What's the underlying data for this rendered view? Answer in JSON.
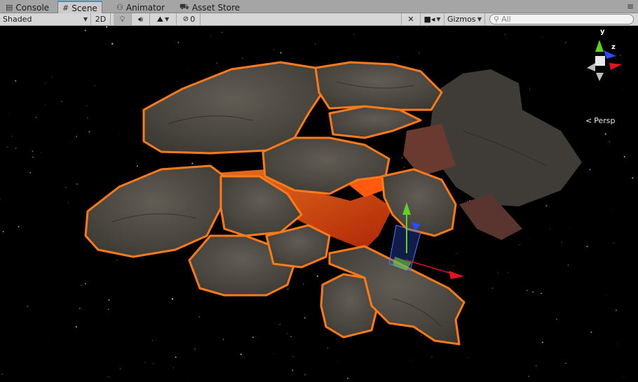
{
  "tabs": [
    {
      "label": "Console",
      "icon": "console-icon"
    },
    {
      "label": "Scene",
      "icon": "grid-icon"
    },
    {
      "label": "Animator",
      "icon": "animator-icon"
    },
    {
      "label": "Asset Store",
      "icon": "store-icon"
    }
  ],
  "active_tab": "Scene",
  "toolbar": {
    "shading_mode": "Shaded",
    "mode_2d": "2D",
    "hidden_count": "0",
    "gizmos_label": "Gizmos",
    "search_placeholder": "All"
  },
  "gizmo": {
    "y_label": "y",
    "z_label": "z",
    "projection_label": "Persp"
  },
  "colors": {
    "outline": "#ff7a1a",
    "lava": "#ff4a10",
    "rock": "#4a4640",
    "axis_x": "#e0141c",
    "axis_y": "#5fd024",
    "axis_z": "#2a4cff",
    "active_tab_accent": "#3d8ce8"
  }
}
